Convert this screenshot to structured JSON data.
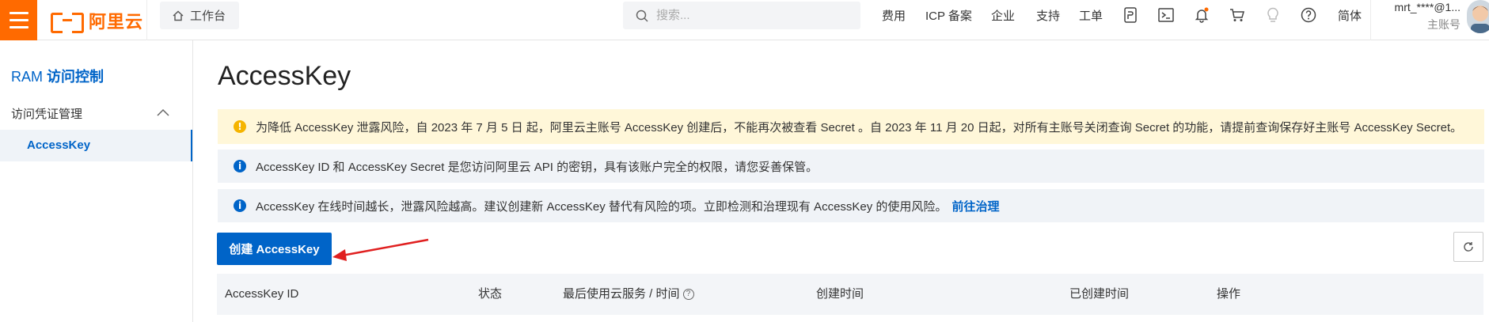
{
  "header": {
    "brand": "阿里云",
    "workbench_label": "工作台",
    "search_placeholder": "搜索...",
    "nav": {
      "fees": "费用",
      "icp": "ICP 备案",
      "enterprise": "企业",
      "support": "支持",
      "ticket": "工单",
      "language": "简体"
    },
    "icons": [
      "app-icon",
      "terminal-icon",
      "bell-icon",
      "cart-icon",
      "lightbulb-icon",
      "help-icon"
    ],
    "user_name": "mrt_****@1...",
    "user_role": "主账号",
    "accent_color": "#ff6a00"
  },
  "sidebar": {
    "title_prefix": "RAM",
    "title_suffix": "访问控制",
    "group_label": "访问凭证管理",
    "active_item": "AccessKey"
  },
  "main": {
    "title": "AccessKey",
    "alerts": {
      "warning": "为降低 AccessKey 泄露风险，自 2023 年 7 月 5 日 起，阿里云主账号 AccessKey 创建后，不能再次被查看 Secret 。自 2023 年 11 月 20 日起，对所有主账号关闭查询 Secret 的功能，请提前查询保存好主账号 AccessKey Secret。",
      "info1": "AccessKey ID 和 AccessKey Secret 是您访问阿里云 API 的密钥，具有该账户完全的权限，请您妥善保管。",
      "info2": "AccessKey 在线时间越长，泄露风险越高。建议创建新 AccessKey 替代有风险的项。立即检测和治理现有 AccessKey 的使用风险。",
      "info2_link": "前往治理"
    },
    "create_button": "创建 AccessKey",
    "table_headers": {
      "id": "AccessKey ID",
      "status": "状态",
      "last_used": "最后使用云服务 / 时间",
      "created_time": "创建时间",
      "created_duration": "已创建时间",
      "actions": "操作"
    },
    "primary_color": "#0064c8"
  }
}
